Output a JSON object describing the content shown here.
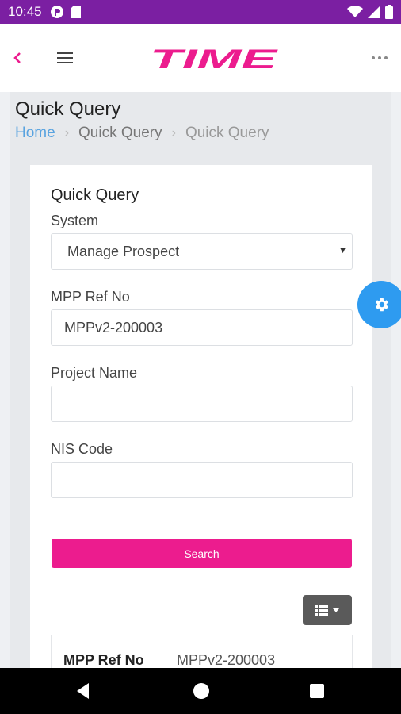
{
  "status_bar": {
    "time": "10:45"
  },
  "header": {
    "logo_text": "TIME",
    "brand_color": "#ec1c8e"
  },
  "page": {
    "title": "Quick Query",
    "breadcrumb": [
      "Home",
      "Quick Query",
      "Quick Query"
    ]
  },
  "form": {
    "title": "Quick Query",
    "system_label": "System",
    "system_value": "Manage Prospect",
    "mpp_label": "MPP Ref No",
    "mpp_value": "MPPv2-200003",
    "project_label": "Project Name",
    "project_value": "",
    "nis_label": "NIS Code",
    "nis_value": "",
    "search_label": "Search"
  },
  "result": {
    "key": "MPP Ref No",
    "value": "MPPv2-200003"
  },
  "icons": {
    "back": "chevron-left-icon",
    "menu": "hamburger-menu-icon",
    "more": "more-horizontal-icon",
    "settings": "gear-icon",
    "view": "list-view-icon"
  },
  "colors": {
    "accent": "#ec1c8e",
    "fab": "#2e9bf0",
    "status_bar": "#7b1fa2"
  }
}
